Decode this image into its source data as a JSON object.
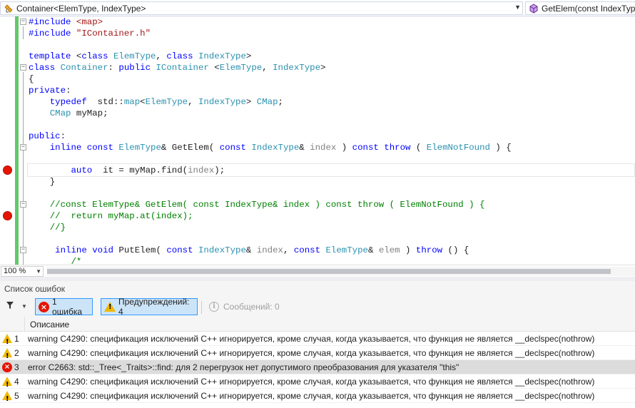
{
  "navbar": {
    "scope": "Container<ElemType, IndexType>",
    "member": "GetElem(const IndexType"
  },
  "code": {
    "l1_a": "#include ",
    "l1_b": "<map>",
    "l2_a": "#include ",
    "l2_b": "\"IContainer.h\"",
    "l4_a": "template",
    "l4_b": " <",
    "l4_c": "class",
    "l4_d": " ",
    "l4_e": "ElemType",
    "l4_f": ", ",
    "l4_g": "class",
    "l4_h": " ",
    "l4_i": "IndexType",
    "l4_j": ">",
    "l5_a": "class",
    "l5_b": " ",
    "l5_c": "Container",
    "l5_d": ": ",
    "l5_e": "public",
    "l5_f": " ",
    "l5_g": "IContainer",
    "l5_h": " <",
    "l5_i": "ElemType",
    "l5_j": ", ",
    "l5_k": "IndexType",
    "l5_l": ">",
    "l6": "{",
    "l7_a": "private",
    "l7_b": ":",
    "l8_a": "    typedef",
    "l8_b": "  std::",
    "l8_c": "map",
    "l8_d": "<",
    "l8_e": "ElemType",
    "l8_f": ", ",
    "l8_g": "IndexType",
    "l8_h": "> ",
    "l8_i": "CMap",
    "l8_j": ";",
    "l9_a": "    ",
    "l9_b": "CMap",
    "l9_c": " myMap;",
    "l11_a": "public",
    "l11_b": ":",
    "l12_a": "    inline",
    "l12_b": " ",
    "l12_c": "const",
    "l12_d": " ",
    "l12_e": "ElemType",
    "l12_f": "& GetElem( ",
    "l12_g": "const",
    "l12_h": " ",
    "l12_i": "IndexType",
    "l12_j": "& ",
    "l12_k": "index",
    "l12_l": " ) ",
    "l12_m": "const",
    "l12_n": " ",
    "l12_o": "throw",
    "l12_p": " ( ",
    "l12_q": "ElemNotFound",
    "l12_r": " ) {",
    "l14_a": "        auto",
    "l14_b": "  it = myMap.find(",
    "l14_c": "index",
    "l14_d": ");",
    "l15": "    }",
    "l17": "    //const ElemType& GetElem( const IndexType& index ) const throw ( ElemNotFound ) {",
    "l18": "    //  return myMap.at(index);",
    "l19": "    //}",
    "l21_a": "     inline",
    "l21_b": " ",
    "l21_c": "void",
    "l21_d": " PutElem( ",
    "l21_e": "const",
    "l21_f": " ",
    "l21_g": "IndexType",
    "l21_h": "& ",
    "l21_i": "index",
    "l21_j": ", ",
    "l21_k": "const",
    "l21_l": " ",
    "l21_m": "ElemType",
    "l21_n": "& ",
    "l21_o": "elem",
    "l21_p": " ) ",
    "l21_q": "throw",
    "l21_r": " () {",
    "l22": "        /*"
  },
  "zoom": "100 %",
  "error_list": {
    "title": "Список ошибок",
    "errors_btn": "1 ошибка",
    "warnings_btn": "Предупреждений: 4",
    "messages_btn": "Сообщений: 0",
    "column_description": "Описание",
    "rows": [
      {
        "type": "warning",
        "num": "1",
        "text": "warning C4290: спецификация исключений C++ игнорируется, кроме случая, когда указывается, что функция не является __declspec(nothrow)"
      },
      {
        "type": "warning",
        "num": "2",
        "text": "warning C4290: спецификация исключений C++ игнорируется, кроме случая, когда указывается, что функция не является __declspec(nothrow)"
      },
      {
        "type": "error",
        "num": "3",
        "text": "error C2663: std::_Tree<_Traits>::find: для 2 перегрузок нет допустимого преобразования для указателя \"this\""
      },
      {
        "type": "warning",
        "num": "4",
        "text": "warning C4290: спецификация исключений C++ игнорируется, кроме случая, когда указывается, что функция не является __declspec(nothrow)"
      },
      {
        "type": "warning",
        "num": "5",
        "text": "warning C4290: спецификация исключений C++ игнорируется, кроме случая, когда указывается, что функция не является __declspec(nothrow)"
      }
    ]
  },
  "colors": {
    "keyword": "#0000ff",
    "type": "#2b91af",
    "string": "#a31515",
    "comment": "#008000",
    "breakpoint": "#e51400",
    "changed_margin": "#63c86b"
  },
  "icons": [
    "class-icon",
    "method-icon",
    "breakpoint-icon",
    "filter-icon",
    "error-icon",
    "warning-icon",
    "info-icon"
  ]
}
